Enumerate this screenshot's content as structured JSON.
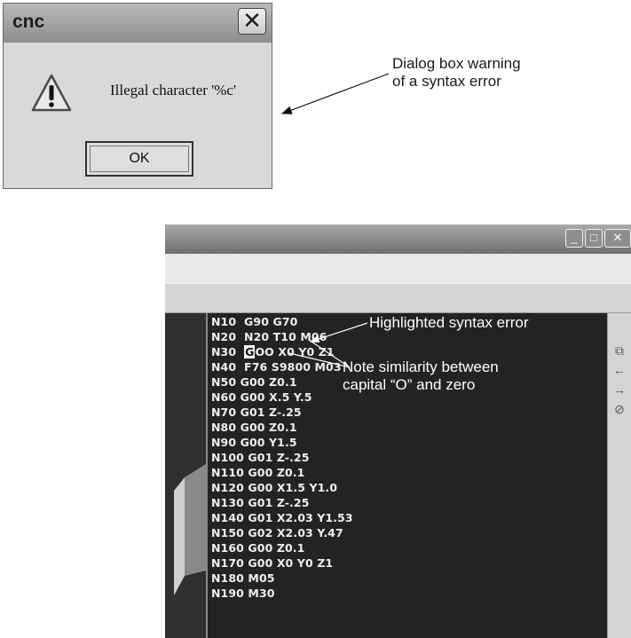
{
  "dialog": {
    "title": "cnc",
    "message": "Illegal character '%c'",
    "ok_label": "OK",
    "close_glyph": "✕",
    "icon": "warning-icon"
  },
  "callouts": {
    "dialog_note_line1": "Dialog box warning",
    "dialog_note_line2": "of a syntax error",
    "highlight_note": "Highlighted syntax error",
    "similarity_line1": "Note similarity between",
    "similarity_line2": "capital “O” and zero"
  },
  "editor": {
    "window_buttons": {
      "minimize": "_",
      "maximize": "□",
      "close": "✕"
    },
    "side_icons": [
      "copy-icon",
      "arrow-left-icon",
      "arrow-right-icon",
      "cancel-icon"
    ],
    "code_lines": [
      "N10  G90 G70",
      "N20  N20 T10 M06",
      "N40  F76 S9800 M03",
      "N50 G00 Z0.1",
      "N60 G00 X.5 Y.5",
      "N70 G01 Z-.25",
      "N80 G00 Z0.1",
      "N90 G00 Y1.5",
      "N100 G01 Z-.25",
      "N110 G00 Z0.1",
      "N120 G00 X1.5 Y1.0",
      "N130 G01 Z-.25",
      "N140 G01 X2.03 Y1.53",
      "N150 G02 X2.03 Y.47",
      "N160 G00 Z0.1",
      "N170 G00 X0 Y0 Z1",
      "N180 M05",
      "N190 M30"
    ],
    "error_line": {
      "prefix": "N30  ",
      "highlight": "G",
      "suffix": "OO X0 Y0 Z1"
    }
  }
}
